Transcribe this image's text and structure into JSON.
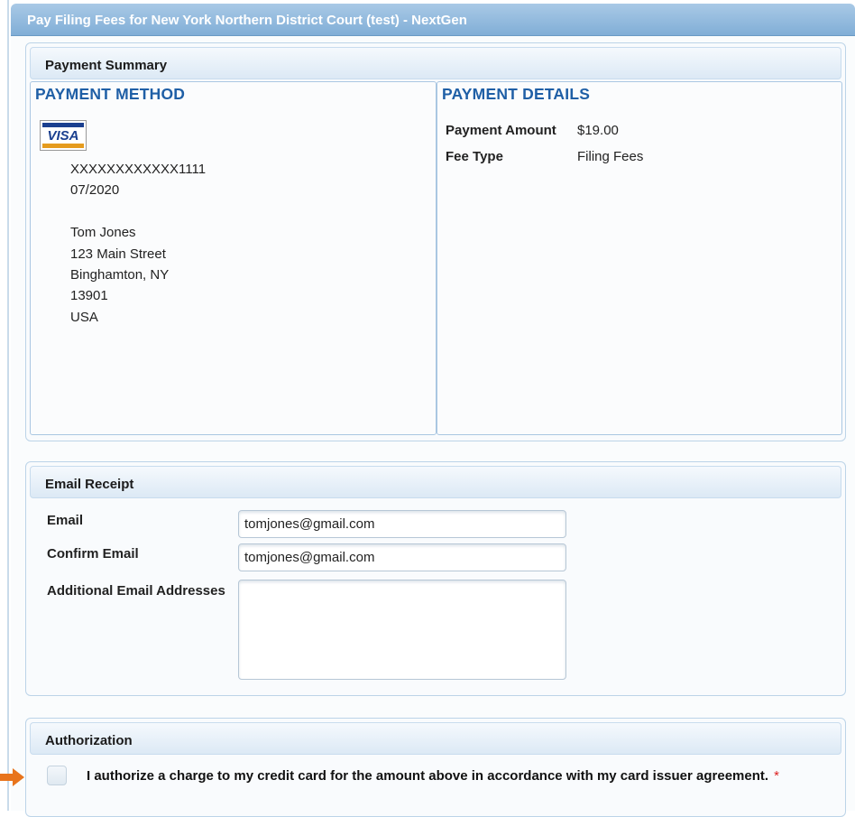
{
  "window": {
    "title": "Pay Filing Fees for New York Northern District Court (test) - NextGen"
  },
  "payment_summary": {
    "header": "Payment Summary",
    "method": {
      "title": "PAYMENT METHOD",
      "card_logo": "VISA",
      "card_number": "XXXXXXXXXXXX1111",
      "expiry": "07/2020",
      "name": "Tom Jones",
      "street": "123 Main Street",
      "city_state": "Binghamton, NY",
      "zip": "13901",
      "country": "USA"
    },
    "details": {
      "title": "PAYMENT DETAILS",
      "amount_label": "Payment Amount",
      "amount_value": "$19.00",
      "fee_type_label": "Fee Type",
      "fee_type_value": "Filing Fees"
    }
  },
  "email_receipt": {
    "header": "Email Receipt",
    "email_label": "Email",
    "email_value": "tomjones@gmail.com",
    "confirm_label": "Confirm Email",
    "confirm_value": "tomjones@gmail.com",
    "additional_label": "Additional Email Addresses",
    "additional_value": ""
  },
  "authorization": {
    "header": "Authorization",
    "checkbox_text": "I authorize a charge to my credit card for the amount above in accordance with my card issuer agreement.",
    "required_marker": "*",
    "checked": false
  },
  "colors": {
    "titlebar": "#7fadd6",
    "pane_title": "#1f5fa6",
    "required": "#d22222",
    "pointer_arrow": "#e8741c"
  }
}
